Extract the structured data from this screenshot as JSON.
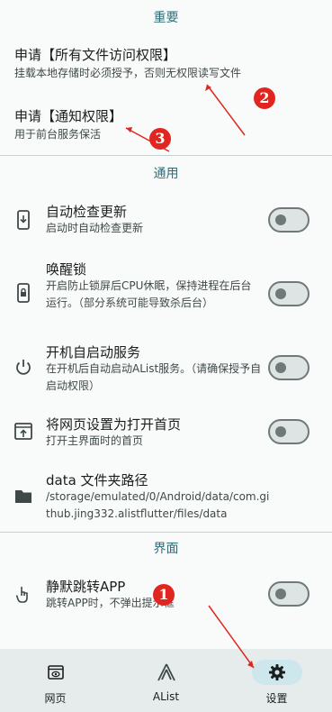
{
  "sections": {
    "important": "重要",
    "general": "通用",
    "interface": "界面"
  },
  "important_items": [
    {
      "title": "申请【所有文件访问权限】",
      "subtitle": "挂载本地存储时必须授予，否则无权限读写文件"
    },
    {
      "title": "申请【通知权限】",
      "subtitle": "用于前台服务保活"
    }
  ],
  "general_items": [
    {
      "title": "自动检查更新",
      "subtitle": "启动时自动检查更新",
      "icon": "download-device-icon",
      "toggle": false
    },
    {
      "title": "唤醒锁",
      "subtitle": "开启防止锁屏后CPU休眠，保持进程在后台运行。（部分系统可能导致杀后台）",
      "icon": "lock-device-icon",
      "toggle": false
    },
    {
      "title": "开机自启动服务",
      "subtitle": "在开机后自动启动AList服务。（请确保授予自启动权限）",
      "icon": "power-icon",
      "toggle": false
    },
    {
      "title": "将网页设置为打开首页",
      "subtitle": "打开主界面时的首页",
      "icon": "open-in-browser-icon",
      "toggle": false
    },
    {
      "title": "data 文件夹路径",
      "subtitle": "/storage/emulated/0/Android/data/com.github.jing332.alistflutter/files/data",
      "icon": "folder-icon"
    }
  ],
  "interface_items": [
    {
      "title": "静默跳转APP",
      "subtitle": "跳转APP时，不弹出提示框",
      "icon": "touch-app-icon",
      "toggle": false
    }
  ],
  "nav": [
    {
      "label": "网页",
      "icon": "web-icon"
    },
    {
      "label": "AList",
      "icon": "alist-logo-icon"
    },
    {
      "label": "设置",
      "icon": "settings-gear-icon",
      "active": true
    }
  ],
  "annotations": [
    "1",
    "2",
    "3"
  ],
  "colors": {
    "accent": "#2d6d78",
    "annotation": "#e0261f",
    "nav_bg": "#e6ecec",
    "active_pill": "#cde7ec"
  }
}
